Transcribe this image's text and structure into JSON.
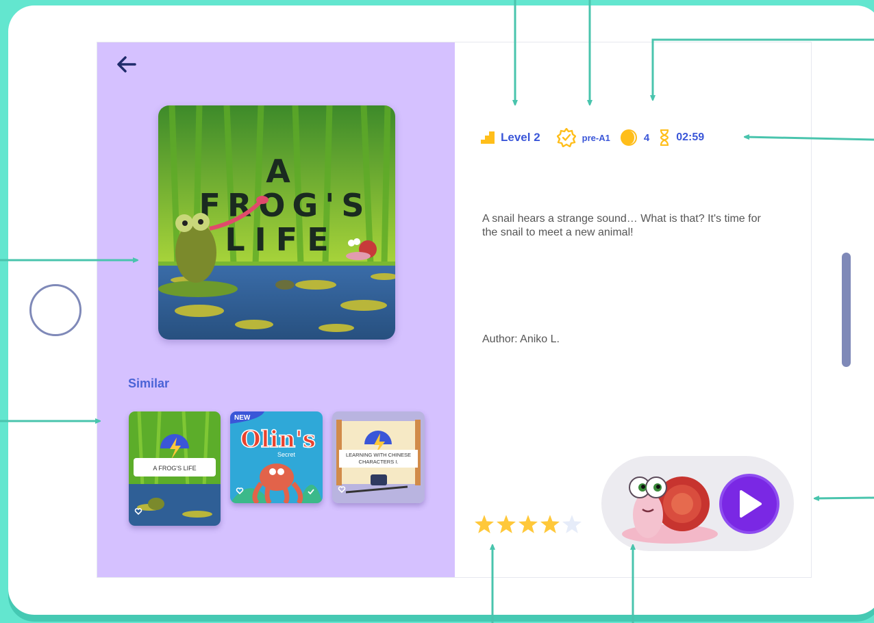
{
  "book": {
    "title_line1": "A",
    "title_line2": "FROG'S",
    "title_line3": "LIFE",
    "description": "A snail hears a strange sound… What is that? It's time for the snail to meet a new animal!",
    "author": "Author: Aniko L."
  },
  "meta": {
    "level": "Level 2",
    "cefr": "pre-A1",
    "count": "4",
    "duration": "02:59"
  },
  "similar": {
    "title": "Similar",
    "items": [
      {
        "label": "A FROG'S LIFE",
        "badge": ""
      },
      {
        "label": "Olin's",
        "sub": "Secret",
        "badge": "NEW"
      },
      {
        "label": "LEARNING WITH CHINESE CHARACTERS I.",
        "badge": ""
      }
    ]
  },
  "rating": {
    "value": 4,
    "max": 5
  },
  "colors": {
    "accent": "#3a56d8",
    "panel": "#d5c1ff",
    "teal": "#63e6cf",
    "play": "#7a28e4",
    "star": "#ffc83a"
  }
}
